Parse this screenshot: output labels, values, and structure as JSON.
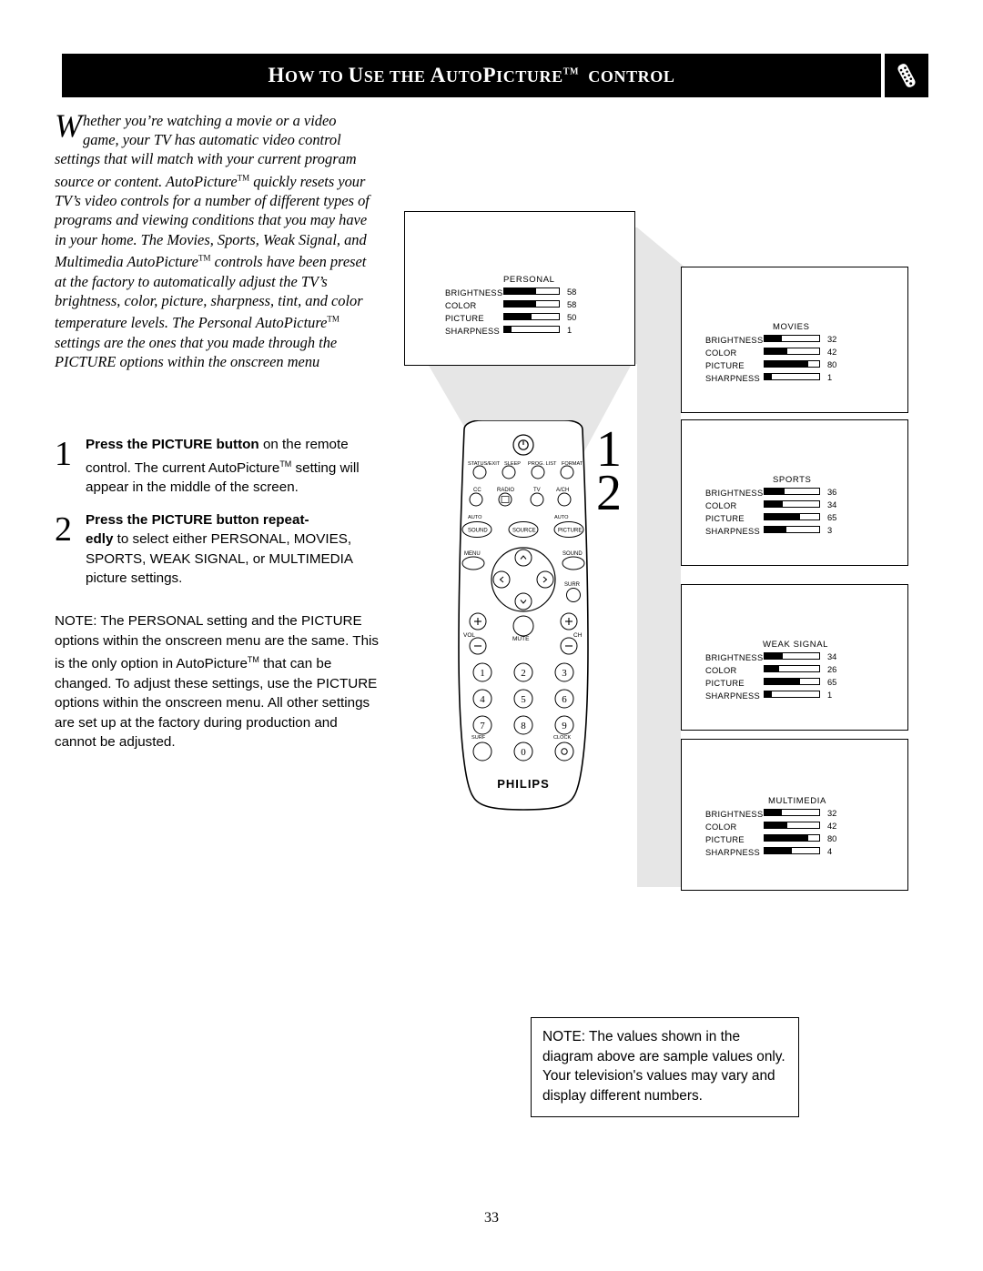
{
  "header": {
    "title_parts": [
      "H",
      "OW TO ",
      "U",
      "SE THE ",
      "A",
      "UTO",
      "P",
      "ICTURE",
      "TM",
      " C",
      "ONTROL"
    ],
    "title_plain": "HOW TO USE THE AUTOPICTURE™ CONTROL",
    "badge_icon": "remote-control-icon"
  },
  "intro": {
    "dropcap": "W",
    "text": "hether you're watching a movie or a video game, your TV has automatic video control settings that will match with your current program source or content. AutoPicture™ quickly resets your TV's video controls for a number of different types of programs and viewing conditions that you may have in your home. The Movies, Sports, Weak Signal, and Multimedia AutoPicture™ controls have been preset at the factory to automatically adjust the TV's brightness, color, picture, sharpness, tint, and color temperature levels. The Personal AutoPicture™ settings are the ones that you made through the PICTURE options within the onscreen menu"
  },
  "steps": [
    {
      "num": "1",
      "bold": "Press the PICTURE button",
      "rest": " on the remote control.  The current AutoPicture™ setting will appear in the middle of the screen."
    },
    {
      "num": "2",
      "bold": "Press the PICTURE button repeatedly",
      "rest": " to select either PERSONAL, MOVIES, SPORTS, WEAK SIGNAL, or MULTIMEDIA picture settings."
    }
  ],
  "note": "NOTE:  The PERSONAL setting and the PICTURE options within the onscreen menu are the same.  This is the only option in AutoPicture™ that can be changed.  To adjust these settings, use the PICTURE options within the onscreen menu.  All other settings are set up at the factory during production and cannot be adjusted.",
  "bottom_note": "NOTE: The values shown in the diagram above are sample values only. Your television's values may vary and display different numbers.",
  "page_number": "33",
  "osd_screens": [
    {
      "name": "personal",
      "title": "PERSONAL",
      "rows": [
        {
          "label": "BRIGHTNESS",
          "value": "58",
          "pct": 58
        },
        {
          "label": "COLOR",
          "value": "58",
          "pct": 58
        },
        {
          "label": "PICTURE",
          "value": "50",
          "pct": 50
        },
        {
          "label": "SHARPNESS",
          "value": "1",
          "pct": 14
        }
      ]
    },
    {
      "name": "movies",
      "title": "MOVIES",
      "rows": [
        {
          "label": "BRIGHTNESS",
          "value": "32",
          "pct": 32
        },
        {
          "label": "COLOR",
          "value": "42",
          "pct": 42
        },
        {
          "label": "PICTURE",
          "value": "80",
          "pct": 80
        },
        {
          "label": "SHARPNESS",
          "value": "1",
          "pct": 14
        }
      ]
    },
    {
      "name": "sports",
      "title": "SPORTS",
      "rows": [
        {
          "label": "BRIGHTNESS",
          "value": "36",
          "pct": 36
        },
        {
          "label": "COLOR",
          "value": "34",
          "pct": 34
        },
        {
          "label": "PICTURE",
          "value": "65",
          "pct": 65
        },
        {
          "label": "SHARPNESS",
          "value": "3",
          "pct": 40
        }
      ]
    },
    {
      "name": "weak-signal",
      "title": "WEAK SIGNAL",
      "rows": [
        {
          "label": "BRIGHTNESS",
          "value": "34",
          "pct": 34
        },
        {
          "label": "COLOR",
          "value": "26",
          "pct": 26
        },
        {
          "label": "PICTURE",
          "value": "65",
          "pct": 65
        },
        {
          "label": "SHARPNESS",
          "value": "1",
          "pct": 14
        }
      ]
    },
    {
      "name": "multimedia",
      "title": "MULTIMEDIA",
      "rows": [
        {
          "label": "BRIGHTNESS",
          "value": "32",
          "pct": 32
        },
        {
          "label": "COLOR",
          "value": "42",
          "pct": 42
        },
        {
          "label": "PICTURE",
          "value": "80",
          "pct": 80
        },
        {
          "label": "SHARPNESS",
          "value": "4",
          "pct": 50
        }
      ]
    }
  ],
  "callouts": {
    "one": "1",
    "two": "2"
  },
  "remote": {
    "brand": "PHILIPS",
    "power_icon": "power-icon",
    "row_labels_1": [
      "STATUS/EXIT",
      "SLEEP",
      "PROG. LIST",
      "FORMAT"
    ],
    "row_labels_2": [
      "CC",
      "RADIO",
      "TV",
      "A/CH"
    ],
    "row_labels_3": [
      "AUTO",
      "",
      "AUTO"
    ],
    "round_buttons": [
      "SOUND",
      "SOURCE",
      "PICTURE"
    ],
    "menu_label": "MENU",
    "sound_label": "SOUND",
    "surr_label": "SURR",
    "vol_label": "VOL",
    "mute_label": "MUTE",
    "ch_label": "CH",
    "keypad": [
      "1",
      "2",
      "3",
      "4",
      "5",
      "6",
      "7",
      "8",
      "9",
      "0"
    ],
    "keypad_extra_labels": [
      "SURF",
      "CLOCK"
    ],
    "plus": "+",
    "minus": "–"
  }
}
